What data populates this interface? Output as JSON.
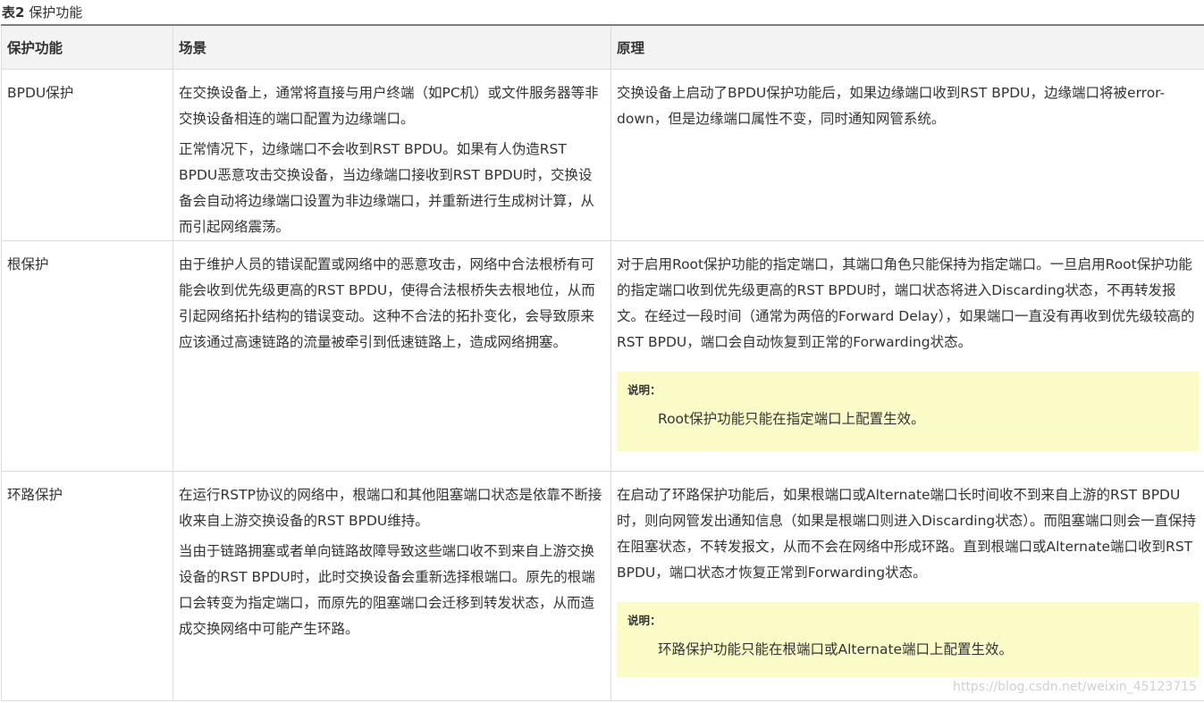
{
  "caption": {
    "number": "表2",
    "title": "保护功能"
  },
  "headers": [
    "保护功能",
    "场景",
    "原理"
  ],
  "rows": [
    {
      "feature": "BPDU保护",
      "scenario": [
        "在交换设备上，通常将直接与用户终端（如PC机）或文件服务器等非交换设备相连的端口配置为边缘端口。",
        "正常情况下，边缘端口不会收到RST BPDU。如果有人伪造RST BPDU恶意攻击交换设备，当边缘端口接收到RST BPDU时，交换设备会自动将边缘端口设置为非边缘端口，并重新进行生成树计算，从而引起网络震荡。"
      ],
      "principle": "交换设备上启动了BPDU保护功能后，如果边缘端口收到RST BPDU，边缘端口将被error-down，但是边缘端口属性不变，同时通知网管系统。",
      "note": null
    },
    {
      "feature": "根保护",
      "scenario": [
        "由于维护人员的错误配置或网络中的恶意攻击，网络中合法根桥有可能会收到优先级更高的RST BPDU，使得合法根桥失去根地位，从而引起网络拓扑结构的错误变动。这种不合法的拓扑变化，会导致原来应该通过高速链路的流量被牵引到低速链路上，造成网络拥塞。"
      ],
      "principle": "对于启用Root保护功能的指定端口，其端口角色只能保持为指定端口。一旦启用Root保护功能的指定端口收到优先级更高的RST BPDU时，端口状态将进入Discarding状态，不再转发报文。在经过一段时间（通常为两倍的Forward Delay），如果端口一直没有再收到优先级较高的RST BPDU，端口会自动恢复到正常的Forwarding状态。",
      "note": {
        "title": "说明：",
        "body": "Root保护功能只能在指定端口上配置生效。"
      }
    },
    {
      "feature": "环路保护",
      "scenario": [
        "在运行RSTP协议的网络中，根端口和其他阻塞端口状态是依靠不断接收来自上游交换设备的RST BPDU维持。",
        "当由于链路拥塞或者单向链路故障导致这些端口收不到来自上游交换设备的RST BPDU时，此时交换设备会重新选择根端口。原先的根端口会转变为指定端口，而原先的阻塞端口会迁移到转发状态，从而造成交换网络中可能产生环路。"
      ],
      "principle": "在启动了环路保护功能后，如果根端口或Alternate端口长时间收不到来自上游的RST BPDU时，则向网管发出通知信息（如果是根端口则进入Discarding状态）。而阻塞端口则会一直保持在阻塞状态，不转发报文，从而不会在网络中形成环路。直到根端口或Alternate端口收到RST BPDU，端口状态才恢复正常到Forwarding状态。",
      "note": {
        "title": "说明：",
        "body": "环路保护功能只能在根端口或Alternate端口上配置生效。"
      }
    }
  ],
  "watermark": "https://blog.csdn.net/weixin_45123715",
  "colors": {
    "header_bg": "#f3f3f3",
    "note_bg": "#fbfbc8",
    "border": "#dcdcdc",
    "text": "#333333"
  }
}
